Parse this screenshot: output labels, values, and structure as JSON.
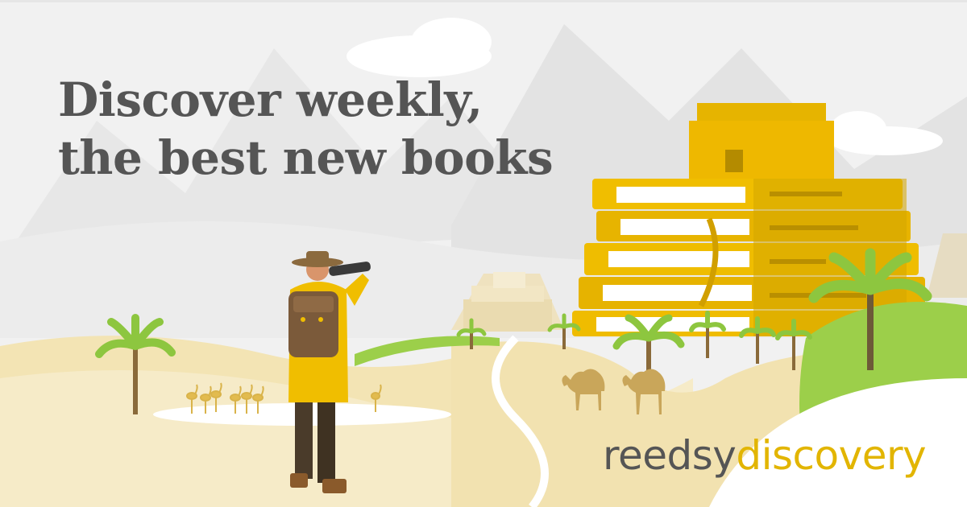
{
  "headline": {
    "line1": "Discover weekly,",
    "line2": "the best new books"
  },
  "brand": {
    "part1": "reedsy",
    "part2": "discovery"
  },
  "colors": {
    "headline_text": "#555555",
    "brand_dark": "#555555",
    "brand_accent": "#e2b500",
    "book_yellow": "#e8b900",
    "sand": "#f3e4b4",
    "palm_green": "#8dc63f"
  },
  "illustration": {
    "elements": [
      "mountains",
      "clouds",
      "book-temple",
      "pyramids",
      "palm-trees",
      "camels",
      "flamingos",
      "oasis",
      "explorer-with-binoculars"
    ]
  }
}
